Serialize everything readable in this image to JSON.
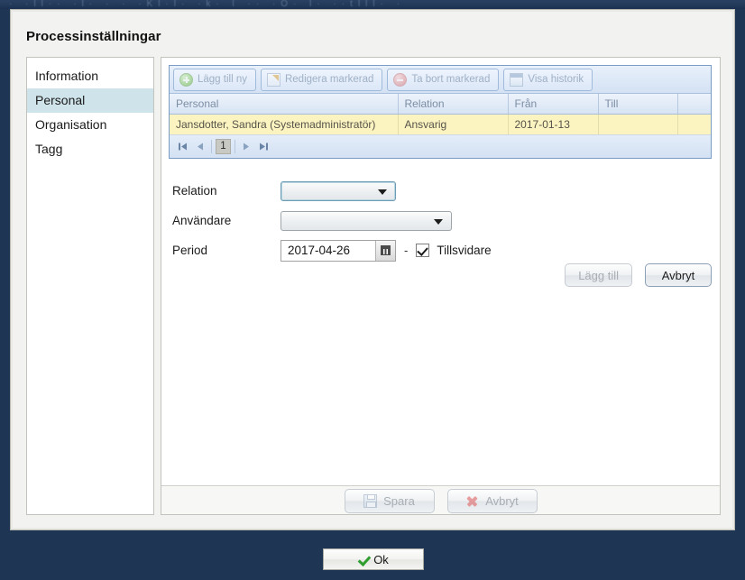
{
  "window": {
    "ghost_strip_text": "· ·ll··       ·l·  ·  ·    ·Kl·l·   ·k· l ·· ·O·   l· ··tlll· ·"
  },
  "dialog": {
    "title": "Processinställningar"
  },
  "sidebar": {
    "items": [
      {
        "label": "Information",
        "selected": false
      },
      {
        "label": "Personal",
        "selected": true
      },
      {
        "label": "Organisation",
        "selected": false
      },
      {
        "label": "Tagg",
        "selected": false
      }
    ]
  },
  "grid": {
    "toolbar": [
      {
        "label": "Lägg till ny",
        "icon": "circle-plus-icon",
        "disabled": true
      },
      {
        "label": "Redigera markerad",
        "icon": "pencil-edit-icon",
        "disabled": true
      },
      {
        "label": "Ta bort markerad",
        "icon": "circle-minus-icon",
        "disabled": true
      },
      {
        "label": "Visa historik",
        "icon": "window-history-icon",
        "disabled": true
      }
    ],
    "columns": [
      "Personal",
      "Relation",
      "Från",
      "Till",
      ""
    ],
    "rows": [
      [
        "Jansdotter, Sandra (Systemadministratör)",
        "Ansvarig",
        "2017-01-13",
        "",
        ""
      ]
    ],
    "pager": {
      "first_label": "first-page",
      "prev_label": "previous-page",
      "current_page": "1",
      "next_label": "next-page",
      "last_label": "last-page"
    }
  },
  "form": {
    "relation": {
      "label": "Relation",
      "value": ""
    },
    "user": {
      "label": "Användare",
      "value": ""
    },
    "period": {
      "label": "Period",
      "from_value": "2017-04-26",
      "separator": "-",
      "ongoing_label": "Tillsvidare",
      "ongoing_checked": true
    },
    "actions": {
      "add_label": "Lägg till",
      "cancel_label": "Avbryt"
    }
  },
  "content_footer": {
    "save_label": "Spara",
    "cancel_label": "Avbryt"
  },
  "bottom_bar": {
    "ok_label": "Ok"
  },
  "colors": {
    "background": "#1e3553",
    "selected_nav": "#cfe3ea",
    "selected_row": "#fcf4c0",
    "grid_border": "#7a9cc4",
    "accent_green": "#2f9e2f",
    "accent_red": "#e06464"
  }
}
